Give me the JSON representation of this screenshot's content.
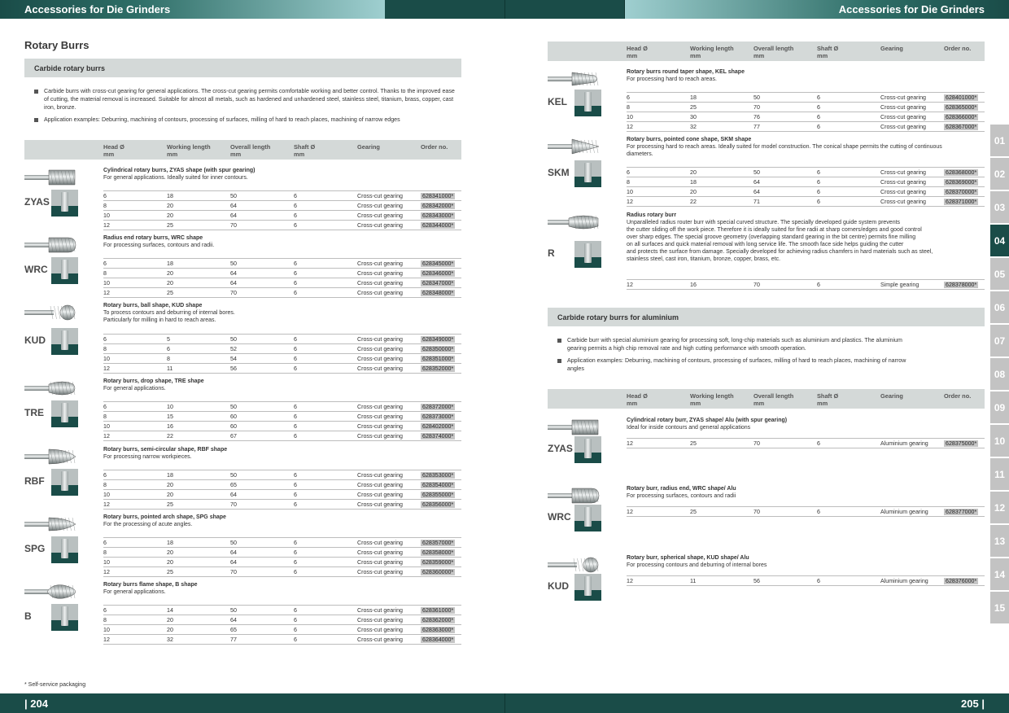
{
  "header": {
    "title_left": "Accessories for Die Grinders",
    "title_right": "Accessories for Die Grinders"
  },
  "section_title": "Rotary Burrs",
  "left": {
    "band": "Carbide rotary burrs",
    "bullets": [
      "Carbide burrs with cross-cut gearing for general applications. The cross-cut gearing permits comfortable working and better control. Thanks to the improved ease of cutting, the material removal is increased. Suitable for almost all metals, such as hardened and unhardened steel, stainless steel, titanium, brass, copper, cast iron, bronze.",
      "Application examples: Deburring, machining of contours, processing of surfaces, milling of hard to reach places, machining of narrow edges"
    ],
    "headers": {
      "head": "Head Ø",
      "head_unit": "mm",
      "working": "Working length",
      "working_unit": "mm",
      "overall": "Overall length",
      "overall_unit": "mm",
      "shaft": "Shaft Ø",
      "shaft_unit": "mm",
      "gearing": "Gearing",
      "order": "Order no."
    },
    "products": [
      {
        "code": "ZYAS",
        "name": "Cylindrical rotary burrs, ZYAS shape (with spur gearing)",
        "desc": [
          "For general applications. Ideally suited for inner contours."
        ],
        "rows": [
          [
            "6",
            "18",
            "50",
            "6",
            "Cross-cut gearing",
            "628341000*"
          ],
          [
            "8",
            "20",
            "64",
            "6",
            "Cross-cut gearing",
            "628342000*"
          ],
          [
            "10",
            "20",
            "64",
            "6",
            "Cross-cut gearing",
            "628343000*"
          ],
          [
            "12",
            "25",
            "70",
            "6",
            "Cross-cut gearing",
            "628344000*"
          ]
        ]
      },
      {
        "code": "WRC",
        "name": "Radius end rotary burrs, WRC shape",
        "desc": [
          "For processing surfaces, contours and radii."
        ],
        "rows": [
          [
            "6",
            "18",
            "50",
            "6",
            "Cross-cut gearing",
            "628345000*"
          ],
          [
            "8",
            "20",
            "64",
            "6",
            "Cross-cut gearing",
            "628346000*"
          ],
          [
            "10",
            "20",
            "64",
            "6",
            "Cross-cut gearing",
            "628347000*"
          ],
          [
            "12",
            "25",
            "70",
            "6",
            "Cross-cut gearing",
            "628348000*"
          ]
        ]
      },
      {
        "code": "KUD",
        "name": "Rotary burrs, ball shape, KUD shape",
        "desc": [
          "To process contours and deburring of internal bores.",
          "Particularly for milling in hard to reach areas."
        ],
        "rows": [
          [
            "6",
            "5",
            "50",
            "6",
            "Cross-cut gearing",
            "628349000*"
          ],
          [
            "8",
            "6",
            "52",
            "6",
            "Cross-cut gearing",
            "628350000*"
          ],
          [
            "10",
            "8",
            "54",
            "6",
            "Cross-cut gearing",
            "628351000*"
          ],
          [
            "12",
            "11",
            "56",
            "6",
            "Cross-cut gearing",
            "628352000*"
          ]
        ]
      },
      {
        "code": "TRE",
        "name": "Rotary burrs, drop shape, TRE shape",
        "desc": [
          "For general applications."
        ],
        "rows": [
          [
            "6",
            "10",
            "50",
            "6",
            "Cross-cut gearing",
            "628372000*"
          ],
          [
            "8",
            "15",
            "60",
            "6",
            "Cross-cut gearing",
            "628373000*"
          ],
          [
            "10",
            "16",
            "60",
            "6",
            "Cross-cut gearing",
            "628402000*"
          ],
          [
            "12",
            "22",
            "67",
            "6",
            "Cross-cut gearing",
            "628374000*"
          ]
        ]
      },
      {
        "code": "RBF",
        "name": "Rotary burrs, semi-circular shape, RBF shape",
        "desc": [
          "For processing narrow workpieces."
        ],
        "rows": [
          [
            "6",
            "18",
            "50",
            "6",
            "Cross-cut gearing",
            "628353000*"
          ],
          [
            "8",
            "20",
            "65",
            "6",
            "Cross-cut gearing",
            "628354000*"
          ],
          [
            "10",
            "20",
            "64",
            "6",
            "Cross-cut gearing",
            "628355000*"
          ],
          [
            "12",
            "25",
            "70",
            "6",
            "Cross-cut gearing",
            "628356000*"
          ]
        ]
      },
      {
        "code": "SPG",
        "name": "Rotary burrs, pointed arch shape, SPG shape",
        "desc": [
          "For the processing of acute angles."
        ],
        "rows": [
          [
            "6",
            "18",
            "50",
            "6",
            "Cross-cut gearing",
            "628357000*"
          ],
          [
            "8",
            "20",
            "64",
            "6",
            "Cross-cut gearing",
            "628358000*"
          ],
          [
            "10",
            "20",
            "64",
            "6",
            "Cross-cut gearing",
            "628359000*"
          ],
          [
            "12",
            "25",
            "70",
            "6",
            "Cross-cut gearing",
            "628360000*"
          ]
        ]
      },
      {
        "code": "B",
        "name": "Rotary burrs flame shape, B shape",
        "desc": [
          "For general applications."
        ],
        "rows": [
          [
            "6",
            "14",
            "50",
            "6",
            "Cross-cut gearing",
            "628361000*"
          ],
          [
            "8",
            "20",
            "64",
            "6",
            "Cross-cut gearing",
            "628362000*"
          ],
          [
            "10",
            "20",
            "65",
            "6",
            "Cross-cut gearing",
            "628363000*"
          ],
          [
            "12",
            "32",
            "77",
            "6",
            "Cross-cut gearing",
            "628364000*"
          ]
        ]
      }
    ]
  },
  "right": {
    "headers": {
      "head": "Head Ø",
      "head_unit": "mm",
      "working": "Working length",
      "working_unit": "mm",
      "overall": "Overall length",
      "overall_unit": "mm",
      "shaft": "Shaft Ø",
      "shaft_unit": "mm",
      "gearing": "Gearing",
      "order": "Order no."
    },
    "products": [
      {
        "code": "KEL",
        "name": "Rotary burrs round taper shape, KEL shape",
        "desc": [
          "For processing hard to reach areas."
        ],
        "rows": [
          [
            "6",
            "18",
            "50",
            "6",
            "Cross-cut gearing",
            "628401000*"
          ],
          [
            "8",
            "25",
            "70",
            "6",
            "Cross-cut gearing",
            "628365000*"
          ],
          [
            "10",
            "30",
            "76",
            "6",
            "Cross-cut gearing",
            "628366000*"
          ],
          [
            "12",
            "32",
            "77",
            "6",
            "Cross-cut gearing",
            "628367000*"
          ]
        ]
      },
      {
        "code": "SKM",
        "name": "Rotary burrs, pointed cone shape, SKM shape",
        "desc": [
          "For processing hard to reach areas. Ideally suited for model construction. The conical shape permits the cutting of continuous",
          "diameters."
        ],
        "rows": [
          [
            "6",
            "20",
            "50",
            "6",
            "Cross-cut gearing",
            "628368000*"
          ],
          [
            "8",
            "18",
            "64",
            "6",
            "Cross-cut gearing",
            "628369000*"
          ],
          [
            "10",
            "20",
            "64",
            "6",
            "Cross-cut gearing",
            "628370000*"
          ],
          [
            "12",
            "22",
            "71",
            "6",
            "Cross-cut gearing",
            "628371000*"
          ]
        ]
      },
      {
        "code": "R",
        "name": "Radius rotary burr",
        "desc": [
          "Unparalleled radius router burr with special curved structure. The specially developed guide system prevents",
          "the cutter sliding off the work piece. Therefore it is ideally suited for fine radii at sharp corners/edges and good control",
          "over sharp edges. The special groove geometry (overlapping standard gearing in the bit centre) permits fine milling",
          "on all surfaces and quick material removal with long service life. The smooth face side helps guiding the cutter",
          "and protects the surface from damage. Specially developed for achieving radius chamfers in hard materials such as steel,",
          "stainless steel, cast iron, titanium, bronze, copper, brass, etc."
        ],
        "rows": [
          [
            "12",
            "16",
            "70",
            "6",
            "Simple gearing",
            "628378000*"
          ]
        ]
      }
    ],
    "alu_band": "Carbide rotary burrs for aluminium",
    "alu_bullets": [
      "Carbide burr with special aluminium gearing for processing soft, long-chip materials such as aluminium and plastics. The aluminium gearing permits a high chip removal rate and high cutting performance with smooth operation.",
      "Application examples: Deburring, machining of contours, processing of surfaces, milling of hard to reach places, machining of narrow angles"
    ],
    "alu_products": [
      {
        "code": "ZYAS",
        "name": "Cylindrical rotary burr, ZYAS shape/ Alu (with spur gearing)",
        "desc": [
          "Ideal for inside contours and general applications"
        ],
        "rows": [
          [
            "12",
            "25",
            "70",
            "6",
            "Aluminium gearing",
            "628375000*"
          ]
        ]
      },
      {
        "code": "WRC",
        "name": "Rotary burr, radius end, WRC shape/ Alu",
        "desc": [
          "For processing surfaces, contours and radii"
        ],
        "rows": [
          [
            "12",
            "25",
            "70",
            "6",
            "Aluminium gearing",
            "628377000*"
          ]
        ]
      },
      {
        "code": "KUD",
        "name": "Rotary burr, spherical shape, KUD shape/ Alu",
        "desc": [
          "For processing contours and deburring of internal bores"
        ],
        "rows": [
          [
            "12",
            "11",
            "56",
            "6",
            "Aluminium gearing",
            "628376000*"
          ]
        ]
      }
    ]
  },
  "tabs": [
    "01",
    "02",
    "03",
    "04",
    "05",
    "06",
    "07",
    "08",
    "09",
    "10",
    "11",
    "12",
    "13",
    "14",
    "15"
  ],
  "active_tab": "04",
  "footnote": "* Self-service packaging",
  "footer": {
    "page_left": "| 204",
    "page_right": "205 |"
  },
  "colors": {
    "dark_teal": "#1a4c48",
    "band_grey": "#d4d9d8",
    "tab_grey": "#c3c3c3"
  }
}
